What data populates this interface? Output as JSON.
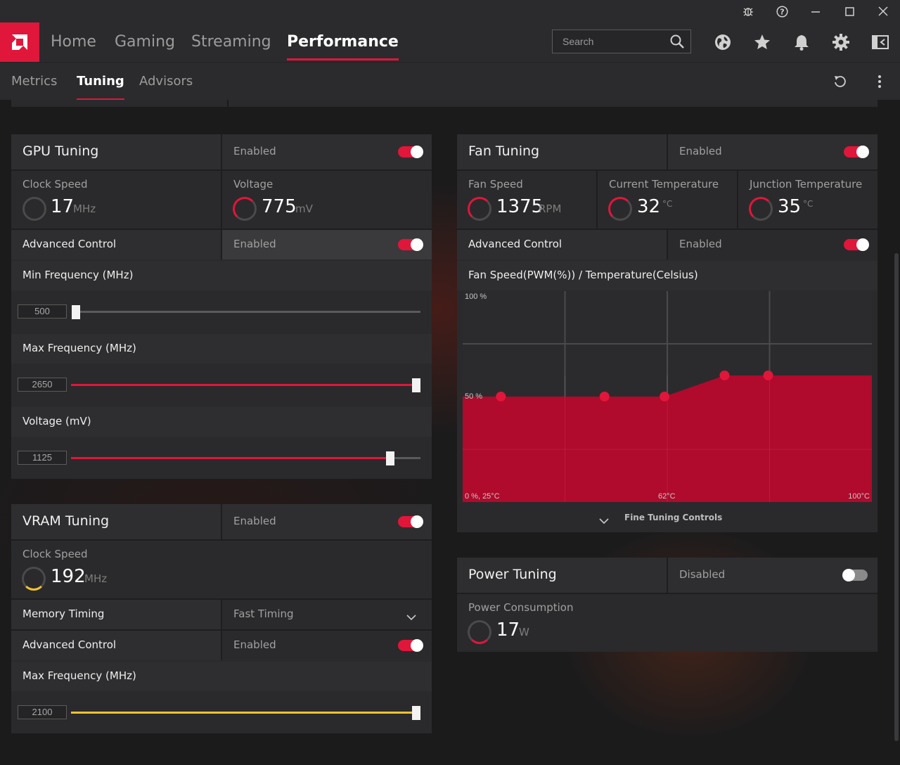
{
  "window": {
    "controls": [
      "bug-icon",
      "help-icon",
      "minimize-icon",
      "maximize-icon",
      "close-icon"
    ]
  },
  "nav": {
    "tabs": [
      {
        "label": "Home"
      },
      {
        "label": "Gaming"
      },
      {
        "label": "Streaming"
      },
      {
        "label": "Performance",
        "active": true
      }
    ],
    "search_placeholder": "Search",
    "icons": [
      "globe-icon",
      "star-icon",
      "bell-icon",
      "gear-icon",
      "sidebar-toggle-icon"
    ]
  },
  "subnav": {
    "tabs": [
      {
        "label": "Metrics"
      },
      {
        "label": "Tuning",
        "active": true
      },
      {
        "label": "Advisors"
      }
    ],
    "icons": [
      "reset-icon",
      "more-icon"
    ]
  },
  "gpu_tuning": {
    "title": "GPU Tuning",
    "status": "Enabled",
    "enabled": true,
    "clock_speed": {
      "label": "Clock Speed",
      "value": "17",
      "unit": "MHz"
    },
    "voltage": {
      "label": "Voltage",
      "value": "775",
      "unit": "mV"
    },
    "advanced_control": {
      "label": "Advanced Control",
      "status": "Enabled",
      "enabled": true
    },
    "min_freq": {
      "label": "Min Frequency (MHz)",
      "value": "500",
      "level": 0.0
    },
    "max_freq": {
      "label": "Max Frequency (MHz)",
      "value": "2650",
      "level": 1.0
    },
    "voltage_slider": {
      "label": "Voltage (mV)",
      "value": "1125",
      "level": 0.9
    }
  },
  "vram_tuning": {
    "title": "VRAM Tuning",
    "status": "Enabled",
    "enabled": true,
    "clock_speed": {
      "label": "Clock Speed",
      "value": "192",
      "unit": "MHz"
    },
    "memory_timing": {
      "label": "Memory Timing",
      "value": "Fast Timing"
    },
    "advanced_control": {
      "label": "Advanced Control",
      "status": "Enabled",
      "enabled": true
    },
    "max_freq": {
      "label": "Max Frequency (MHz)",
      "value": "2100",
      "level": 1.0
    }
  },
  "fan_tuning": {
    "title": "Fan Tuning",
    "status": "Enabled",
    "enabled": true,
    "fan_speed": {
      "label": "Fan Speed",
      "value": "1375",
      "unit": "RPM"
    },
    "current_temp": {
      "label": "Current Temperature",
      "value": "32",
      "unit": "°C"
    },
    "junction_temp": {
      "label": "Junction Temperature",
      "value": "35",
      "unit": "°C"
    },
    "advanced_control": {
      "label": "Advanced Control",
      "status": "Enabled",
      "enabled": true
    },
    "curve_label": "Fan Speed(PWM(%)) / Temperature(Celsius)",
    "fine_tuning_label": "Fine Tuning Controls"
  },
  "power_tuning": {
    "title": "Power Tuning",
    "status": "Disabled",
    "enabled": false,
    "consumption": {
      "label": "Power Consumption",
      "value": "17",
      "unit": "W"
    }
  },
  "chart_data": {
    "type": "area",
    "title": "Fan Speed(PWM(%)) / Temperature(Celsius)",
    "xlabel": "",
    "ylabel": "",
    "x": [
      32,
      51,
      62,
      73,
      81
    ],
    "series": [
      {
        "values": [
          50,
          50,
          50,
          60,
          60
        ]
      }
    ],
    "xlim": [
      25,
      100
    ],
    "ylim": [
      0,
      100
    ],
    "tick_labels": {
      "y_top": "100 %",
      "y_mid": "50 %",
      "origin": "0 %, 25°C",
      "x_mid": "62°C",
      "x_max": "100°C"
    },
    "grid": true,
    "color": "#b00a2c",
    "point_color": "#e0163a"
  },
  "colors": {
    "accent": "#e0163a",
    "vram_slider": "#f2c230",
    "panel": "#2a2a2c"
  }
}
